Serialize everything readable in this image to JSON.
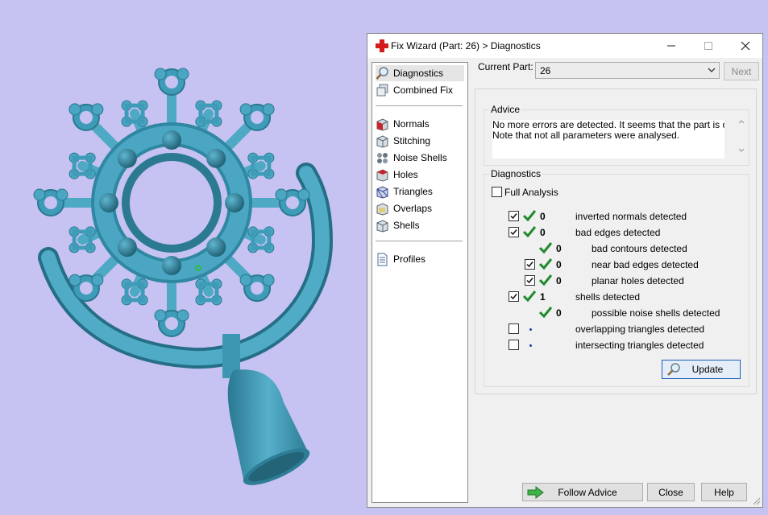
{
  "window": {
    "title": "Fix Wizard (Part: 26) > Diagnostics"
  },
  "nav": {
    "items": [
      {
        "label": "Diagnostics"
      },
      {
        "label": "Combined Fix"
      },
      {
        "label": "Normals"
      },
      {
        "label": "Stitching"
      },
      {
        "label": "Noise Shells"
      },
      {
        "label": "Holes"
      },
      {
        "label": "Triangles"
      },
      {
        "label": "Overlaps"
      },
      {
        "label": "Shells"
      },
      {
        "label": "Profiles"
      }
    ]
  },
  "part": {
    "label": "Current Part:",
    "value": "26",
    "next_label": "Next"
  },
  "advice": {
    "title": "Advice",
    "line1": "No more errors are detected. It seems that the part is ok.",
    "line2": "Note that not all parameters were analysed."
  },
  "diagnostics": {
    "title": "Diagnostics",
    "full_analysis_label": "Full Analysis",
    "rows": [
      {
        "count": "0",
        "label": "inverted normals detected"
      },
      {
        "count": "0",
        "label": "bad edges detected"
      },
      {
        "count": "0",
        "label": "bad contours detected"
      },
      {
        "count": "0",
        "label": "near bad edges detected"
      },
      {
        "count": "0",
        "label": "planar holes detected"
      },
      {
        "count": "1",
        "label": "shells detected"
      },
      {
        "count": "0",
        "label": "possible noise shells detected"
      },
      {
        "count": "",
        "label": "overlapping triangles detected"
      },
      {
        "count": "",
        "label": "intersecting triangles detected"
      }
    ],
    "update_label": "Update"
  },
  "footer": {
    "follow_advice_label": "Follow Advice",
    "close_label": "Close",
    "help_label": "Help"
  },
  "colors": {
    "background": "#c6c2f2",
    "model": "#4ea9c4",
    "check": "#1f8a2b"
  }
}
